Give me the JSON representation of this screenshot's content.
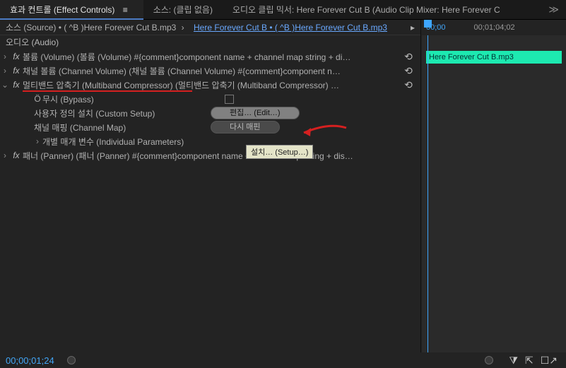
{
  "tabs": {
    "effect_controls": "효과 컨트롤 (Effect Controls)",
    "source_none": "소스: (클립 없음)",
    "mixer": "오디오 클립 믹서: Here Forever Cut B (Audio Clip Mixer: Here Forever C"
  },
  "header": {
    "source_prefix": "소스 (Source) •",
    "source_clip": "( ^B )Here Forever Cut B.mp3",
    "linked_clip": "Here Forever Cut B • ( ^B )Here Forever Cut B.mp3"
  },
  "sections": {
    "audio": "오디오 (Audio)"
  },
  "effects": {
    "volume": "볼륨 (Volume)   (볼륨 (Volume)  #{comment}component name + channel map string + di…",
    "channel_volume": "채널 볼륨 (Channel Volume)   (채널 볼륨 (Channel Volume)  #{comment}component n…",
    "multiband": "멀티밴드 압축기 (Multiband Compressor)   (멀티밴드 압축기 (Multiband Compressor) …",
    "panner": "패너 (Panner)   (패너 (Panner)  #{comment}component name + channel map string + dis…"
  },
  "multiband": {
    "bypass": "무시 (Bypass)",
    "custom_setup": "사용자 정의 설치 (Custom Setup)",
    "channel_map": "채널 매핑 (Channel Map)",
    "individual_params": "개별 매개 변수 (Individual Parameters)",
    "edit_btn": "편집… (Edit…)",
    "remap_btn_visible": "다시 매핀",
    "tooltip": "설치… (Setup…)"
  },
  "timeline": {
    "start": "00;00",
    "end": "00;01;04;02",
    "clip_name": "Here Forever Cut B.mp3"
  },
  "status": {
    "timecode": "00;00;01;24"
  },
  "icons": {
    "menu": "≡",
    "nav_next": "≫",
    "reset": "⟲",
    "bypass_clock": "Ö",
    "caret_right": "›",
    "caret_down": "⌄",
    "filter": "▼▲",
    "in_out": "↥",
    "export": "↦"
  }
}
